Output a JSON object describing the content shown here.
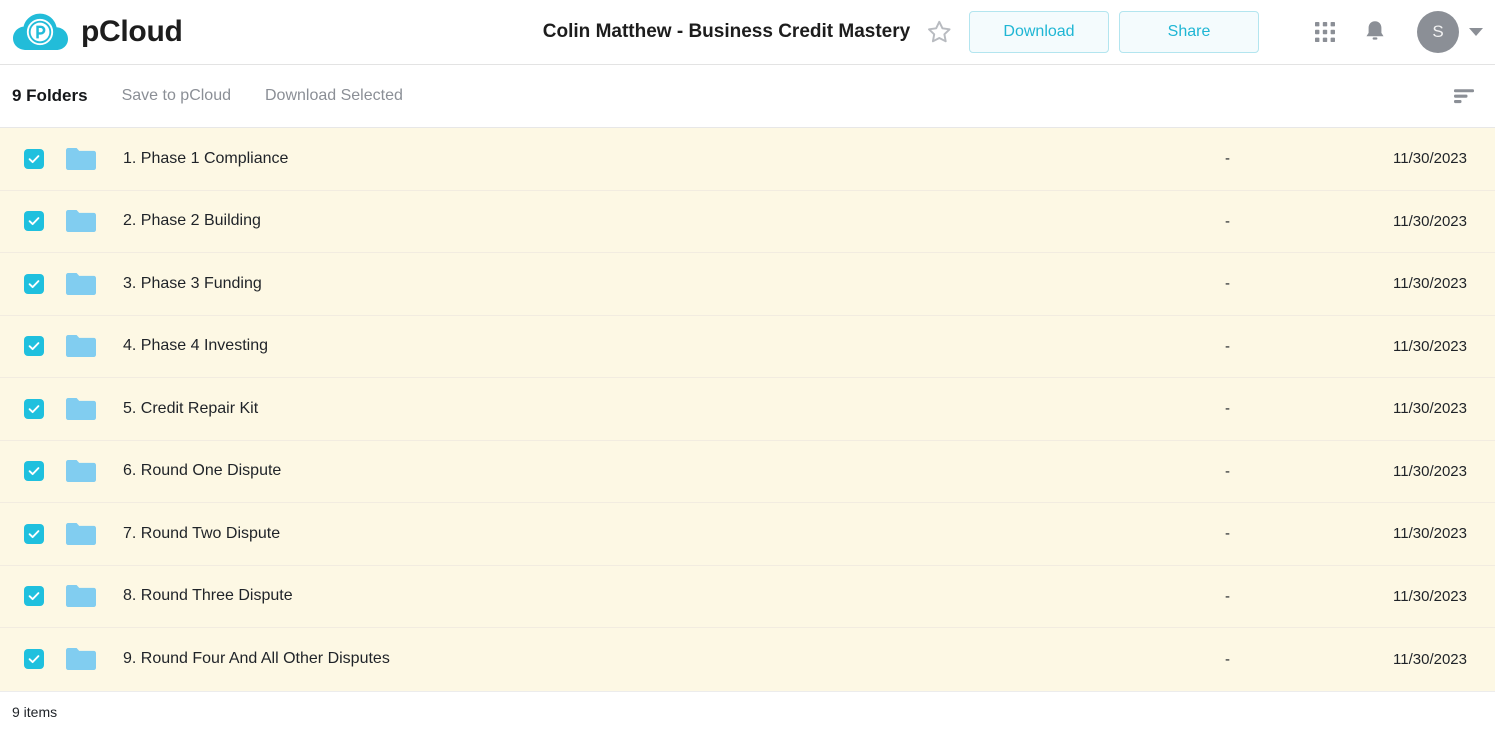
{
  "brand": {
    "name": "pCloud",
    "logo_icon": "pcloud-cloud-p-logo",
    "accent_color": "#1fc0de"
  },
  "header": {
    "title": "Colin Matthew - Business Credit Mastery",
    "star_icon": "star-outline-icon",
    "download_label": "Download",
    "share_label": "Share",
    "grid_icon": "apps-grid-icon",
    "bell_icon": "notification-bell-icon",
    "avatar_initial": "S",
    "caret_icon": "chevron-down-icon"
  },
  "toolbar": {
    "count_label": "9 Folders",
    "save_label": "Save to pCloud",
    "download_selected_label": "Download Selected",
    "sort_icon": "sort-icon"
  },
  "list": {
    "rows": [
      {
        "name": "1. Phase 1 Compliance",
        "size": "-",
        "date": "11/30/2023",
        "checked": true,
        "icon": "folder-icon"
      },
      {
        "name": "2. Phase 2 Building",
        "size": "-",
        "date": "11/30/2023",
        "checked": true,
        "icon": "folder-icon"
      },
      {
        "name": "3. Phase 3 Funding",
        "size": "-",
        "date": "11/30/2023",
        "checked": true,
        "icon": "folder-icon"
      },
      {
        "name": "4. Phase 4 Investing",
        "size": "-",
        "date": "11/30/2023",
        "checked": true,
        "icon": "folder-icon"
      },
      {
        "name": "5. Credit Repair Kit",
        "size": "-",
        "date": "11/30/2023",
        "checked": true,
        "icon": "folder-icon"
      },
      {
        "name": "6. Round One Dispute",
        "size": "-",
        "date": "11/30/2023",
        "checked": true,
        "icon": "folder-icon"
      },
      {
        "name": "7. Round Two Dispute",
        "size": "-",
        "date": "11/30/2023",
        "checked": true,
        "icon": "folder-icon"
      },
      {
        "name": "8. Round Three Dispute",
        "size": "-",
        "date": "11/30/2023",
        "checked": true,
        "icon": "folder-icon"
      },
      {
        "name": "9. Round Four And All Other Disputes",
        "size": "-",
        "date": "11/30/2023",
        "checked": true,
        "icon": "folder-icon"
      }
    ]
  },
  "footer": {
    "items_label": "9 items"
  }
}
